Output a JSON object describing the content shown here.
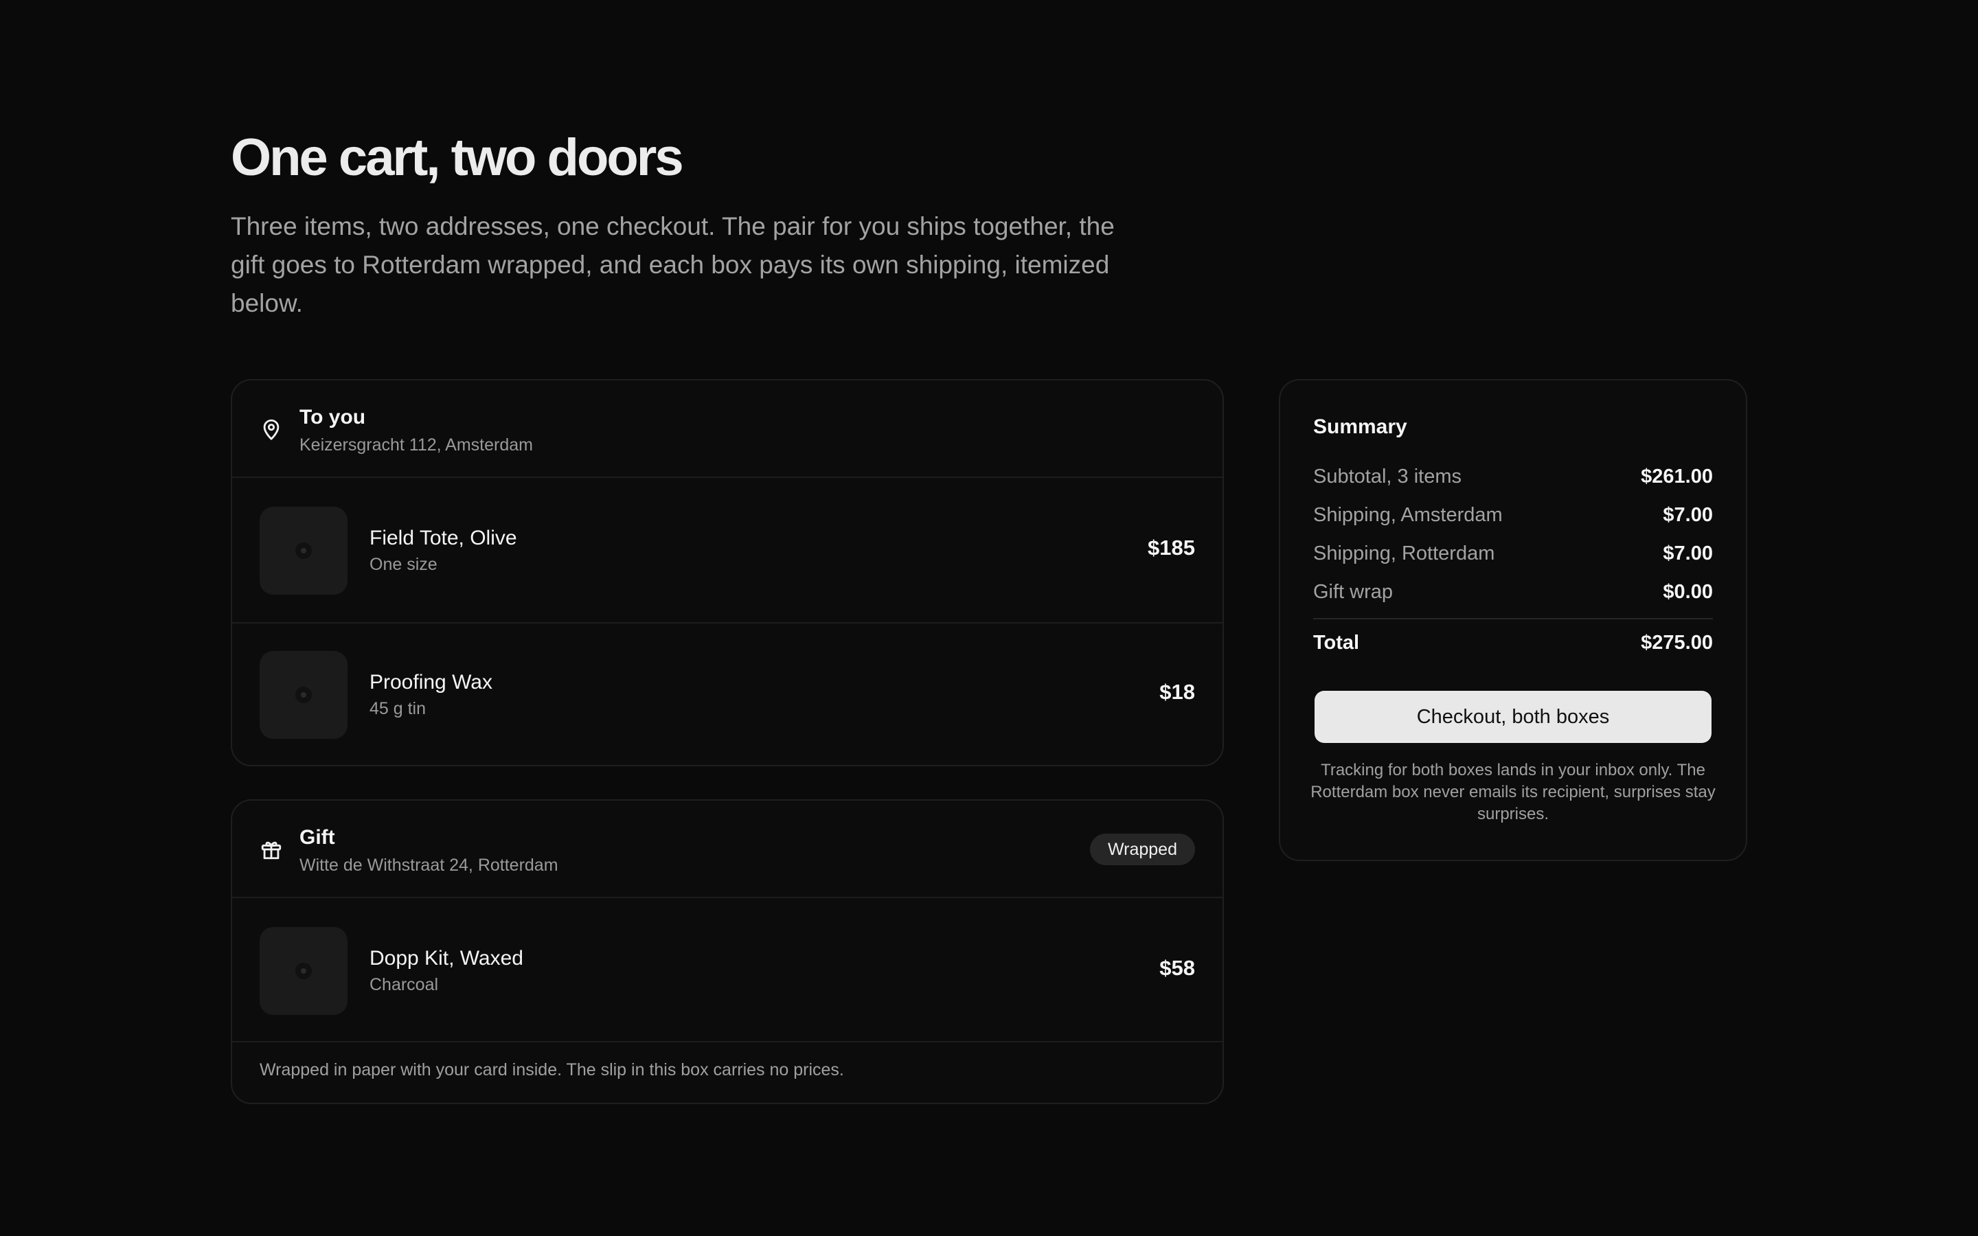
{
  "page": {
    "title": "One cart, two doors",
    "intro": "Three items, two addresses, one checkout. The pair for you ships together, the gift goes to Rotterdam wrapped, and each box pays its own shipping, itemized below."
  },
  "shipments": [
    {
      "icon": "map-pin-icon",
      "name": "To you",
      "address": "Keizersgracht 112, Amsterdam",
      "items": [
        {
          "name": "Field Tote, Olive",
          "variant": "One size",
          "price": "$185"
        },
        {
          "name": "Proofing Wax",
          "variant": "45 g tin",
          "price": "$18"
        }
      ]
    },
    {
      "icon": "gift-icon",
      "name": "Gift",
      "address": "Witte de Withstraat 24, Rotterdam",
      "badge": "Wrapped",
      "items": [
        {
          "name": "Dopp Kit, Waxed",
          "variant": "Charcoal",
          "price": "$58"
        }
      ],
      "note": "Wrapped in paper with your card inside. The slip in this box carries no prices."
    }
  ],
  "summary": {
    "heading": "Summary",
    "rows": [
      {
        "label": "Subtotal, 3 items",
        "value": "$261.00"
      },
      {
        "label": "Shipping, Amsterdam",
        "value": "$7.00"
      },
      {
        "label": "Shipping, Rotterdam",
        "value": "$7.00"
      },
      {
        "label": "Gift wrap",
        "value": "$0.00"
      }
    ],
    "total": {
      "label": "Total",
      "value": "$275.00"
    },
    "button": "Checkout, both boxes",
    "fine_print": "Tracking for both boxes lands in your inbox only. The Rotterdam box never emails its recipient, surprises stay surprises."
  },
  "colors": {
    "background": "#0a0a0a",
    "card_border": "#1f1f1f",
    "button_bg": "#e8e8e8",
    "muted_text": "#a3a3a3"
  }
}
